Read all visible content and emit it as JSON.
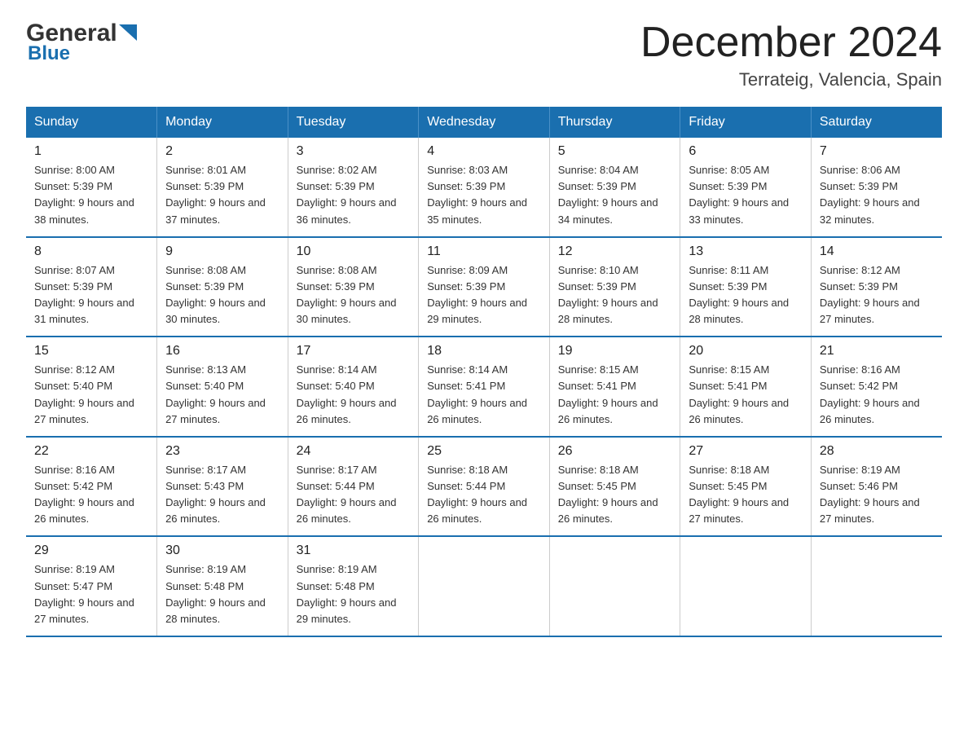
{
  "logo": {
    "general": "General",
    "blue": "Blue"
  },
  "title": "December 2024",
  "subtitle": "Terrateig, Valencia, Spain",
  "headers": [
    "Sunday",
    "Monday",
    "Tuesday",
    "Wednesday",
    "Thursday",
    "Friday",
    "Saturday"
  ],
  "weeks": [
    [
      {
        "day": "1",
        "sunrise": "8:00 AM",
        "sunset": "5:39 PM",
        "daylight": "9 hours and 38 minutes."
      },
      {
        "day": "2",
        "sunrise": "8:01 AM",
        "sunset": "5:39 PM",
        "daylight": "9 hours and 37 minutes."
      },
      {
        "day": "3",
        "sunrise": "8:02 AM",
        "sunset": "5:39 PM",
        "daylight": "9 hours and 36 minutes."
      },
      {
        "day": "4",
        "sunrise": "8:03 AM",
        "sunset": "5:39 PM",
        "daylight": "9 hours and 35 minutes."
      },
      {
        "day": "5",
        "sunrise": "8:04 AM",
        "sunset": "5:39 PM",
        "daylight": "9 hours and 34 minutes."
      },
      {
        "day": "6",
        "sunrise": "8:05 AM",
        "sunset": "5:39 PM",
        "daylight": "9 hours and 33 minutes."
      },
      {
        "day": "7",
        "sunrise": "8:06 AM",
        "sunset": "5:39 PM",
        "daylight": "9 hours and 32 minutes."
      }
    ],
    [
      {
        "day": "8",
        "sunrise": "8:07 AM",
        "sunset": "5:39 PM",
        "daylight": "9 hours and 31 minutes."
      },
      {
        "day": "9",
        "sunrise": "8:08 AM",
        "sunset": "5:39 PM",
        "daylight": "9 hours and 30 minutes."
      },
      {
        "day": "10",
        "sunrise": "8:08 AM",
        "sunset": "5:39 PM",
        "daylight": "9 hours and 30 minutes."
      },
      {
        "day": "11",
        "sunrise": "8:09 AM",
        "sunset": "5:39 PM",
        "daylight": "9 hours and 29 minutes."
      },
      {
        "day": "12",
        "sunrise": "8:10 AM",
        "sunset": "5:39 PM",
        "daylight": "9 hours and 28 minutes."
      },
      {
        "day": "13",
        "sunrise": "8:11 AM",
        "sunset": "5:39 PM",
        "daylight": "9 hours and 28 minutes."
      },
      {
        "day": "14",
        "sunrise": "8:12 AM",
        "sunset": "5:39 PM",
        "daylight": "9 hours and 27 minutes."
      }
    ],
    [
      {
        "day": "15",
        "sunrise": "8:12 AM",
        "sunset": "5:40 PM",
        "daylight": "9 hours and 27 minutes."
      },
      {
        "day": "16",
        "sunrise": "8:13 AM",
        "sunset": "5:40 PM",
        "daylight": "9 hours and 27 minutes."
      },
      {
        "day": "17",
        "sunrise": "8:14 AM",
        "sunset": "5:40 PM",
        "daylight": "9 hours and 26 minutes."
      },
      {
        "day": "18",
        "sunrise": "8:14 AM",
        "sunset": "5:41 PM",
        "daylight": "9 hours and 26 minutes."
      },
      {
        "day": "19",
        "sunrise": "8:15 AM",
        "sunset": "5:41 PM",
        "daylight": "9 hours and 26 minutes."
      },
      {
        "day": "20",
        "sunrise": "8:15 AM",
        "sunset": "5:41 PM",
        "daylight": "9 hours and 26 minutes."
      },
      {
        "day": "21",
        "sunrise": "8:16 AM",
        "sunset": "5:42 PM",
        "daylight": "9 hours and 26 minutes."
      }
    ],
    [
      {
        "day": "22",
        "sunrise": "8:16 AM",
        "sunset": "5:42 PM",
        "daylight": "9 hours and 26 minutes."
      },
      {
        "day": "23",
        "sunrise": "8:17 AM",
        "sunset": "5:43 PM",
        "daylight": "9 hours and 26 minutes."
      },
      {
        "day": "24",
        "sunrise": "8:17 AM",
        "sunset": "5:44 PM",
        "daylight": "9 hours and 26 minutes."
      },
      {
        "day": "25",
        "sunrise": "8:18 AM",
        "sunset": "5:44 PM",
        "daylight": "9 hours and 26 minutes."
      },
      {
        "day": "26",
        "sunrise": "8:18 AM",
        "sunset": "5:45 PM",
        "daylight": "9 hours and 26 minutes."
      },
      {
        "day": "27",
        "sunrise": "8:18 AM",
        "sunset": "5:45 PM",
        "daylight": "9 hours and 27 minutes."
      },
      {
        "day": "28",
        "sunrise": "8:19 AM",
        "sunset": "5:46 PM",
        "daylight": "9 hours and 27 minutes."
      }
    ],
    [
      {
        "day": "29",
        "sunrise": "8:19 AM",
        "sunset": "5:47 PM",
        "daylight": "9 hours and 27 minutes."
      },
      {
        "day": "30",
        "sunrise": "8:19 AM",
        "sunset": "5:48 PM",
        "daylight": "9 hours and 28 minutes."
      },
      {
        "day": "31",
        "sunrise": "8:19 AM",
        "sunset": "5:48 PM",
        "daylight": "9 hours and 29 minutes."
      },
      null,
      null,
      null,
      null
    ]
  ]
}
